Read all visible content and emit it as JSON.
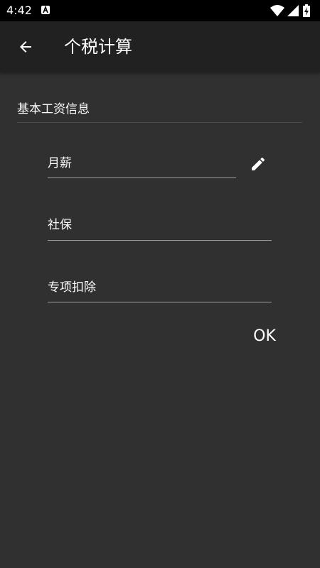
{
  "status_bar": {
    "time": "4:42",
    "app_icon": "a-letter-icon",
    "icons": [
      "wifi-icon",
      "signal-icon",
      "battery-icon"
    ]
  },
  "app_bar": {
    "back_icon": "arrow-back-icon",
    "title": "个税计算"
  },
  "form": {
    "section_title": "基本工资信息",
    "fields": [
      {
        "label": "月薪",
        "action_icon": "pencil-edit-icon"
      },
      {
        "label": "社保"
      },
      {
        "label": "专项扣除"
      }
    ],
    "ok_label": "OK"
  },
  "colors": {
    "background": "#303030",
    "app_bar": "#212121",
    "status_bar": "#000000",
    "text": "#ffffff",
    "underline": "#9e9e9e"
  }
}
